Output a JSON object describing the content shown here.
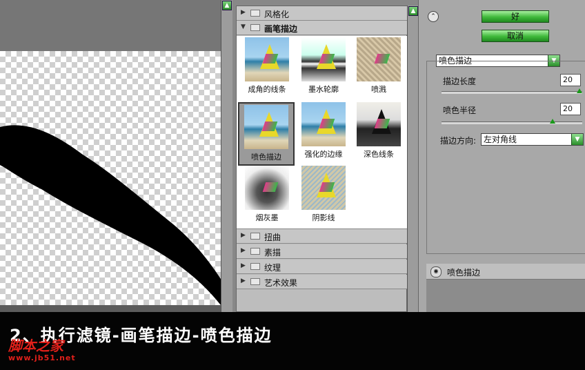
{
  "filter_list": {
    "categories_top": [
      {
        "label": "风格化",
        "expanded": false
      },
      {
        "label": "画笔描边",
        "expanded": true
      }
    ],
    "thumbnails": [
      {
        "label": "成角的线条",
        "selected": false
      },
      {
        "label": "墨水轮廓",
        "selected": false
      },
      {
        "label": "喷溅",
        "selected": false
      },
      {
        "label": "喷色描边",
        "selected": true
      },
      {
        "label": "强化的边缘",
        "selected": false
      },
      {
        "label": "深色线条",
        "selected": false
      },
      {
        "label": "烟灰墨",
        "selected": false
      },
      {
        "label": "阴影线",
        "selected": false
      }
    ],
    "categories_bottom": [
      {
        "label": "扭曲",
        "expanded": false
      },
      {
        "label": "素描",
        "expanded": false
      },
      {
        "label": "纹理",
        "expanded": false
      },
      {
        "label": "艺术效果",
        "expanded": false
      }
    ]
  },
  "buttons": {
    "ok": "好",
    "cancel": "取消"
  },
  "controls": {
    "filter_select": "喷色描边",
    "stroke_length": {
      "label": "描边长度",
      "value": "20",
      "level": 1.0
    },
    "spray_radius": {
      "label": "喷色半径",
      "value": "20",
      "level": 0.8
    },
    "stroke_direction": {
      "label": "描边方向:",
      "value": "左对角线"
    }
  },
  "layer": {
    "name": "喷色描边"
  },
  "caption": "2、执行滤镜-画笔描边-喷色描边",
  "watermark": {
    "title": "脚本之家",
    "url": "www.jb51.net"
  },
  "colors": {
    "accent_green": "#3fb83a",
    "watermark_red": "#e0201a"
  }
}
